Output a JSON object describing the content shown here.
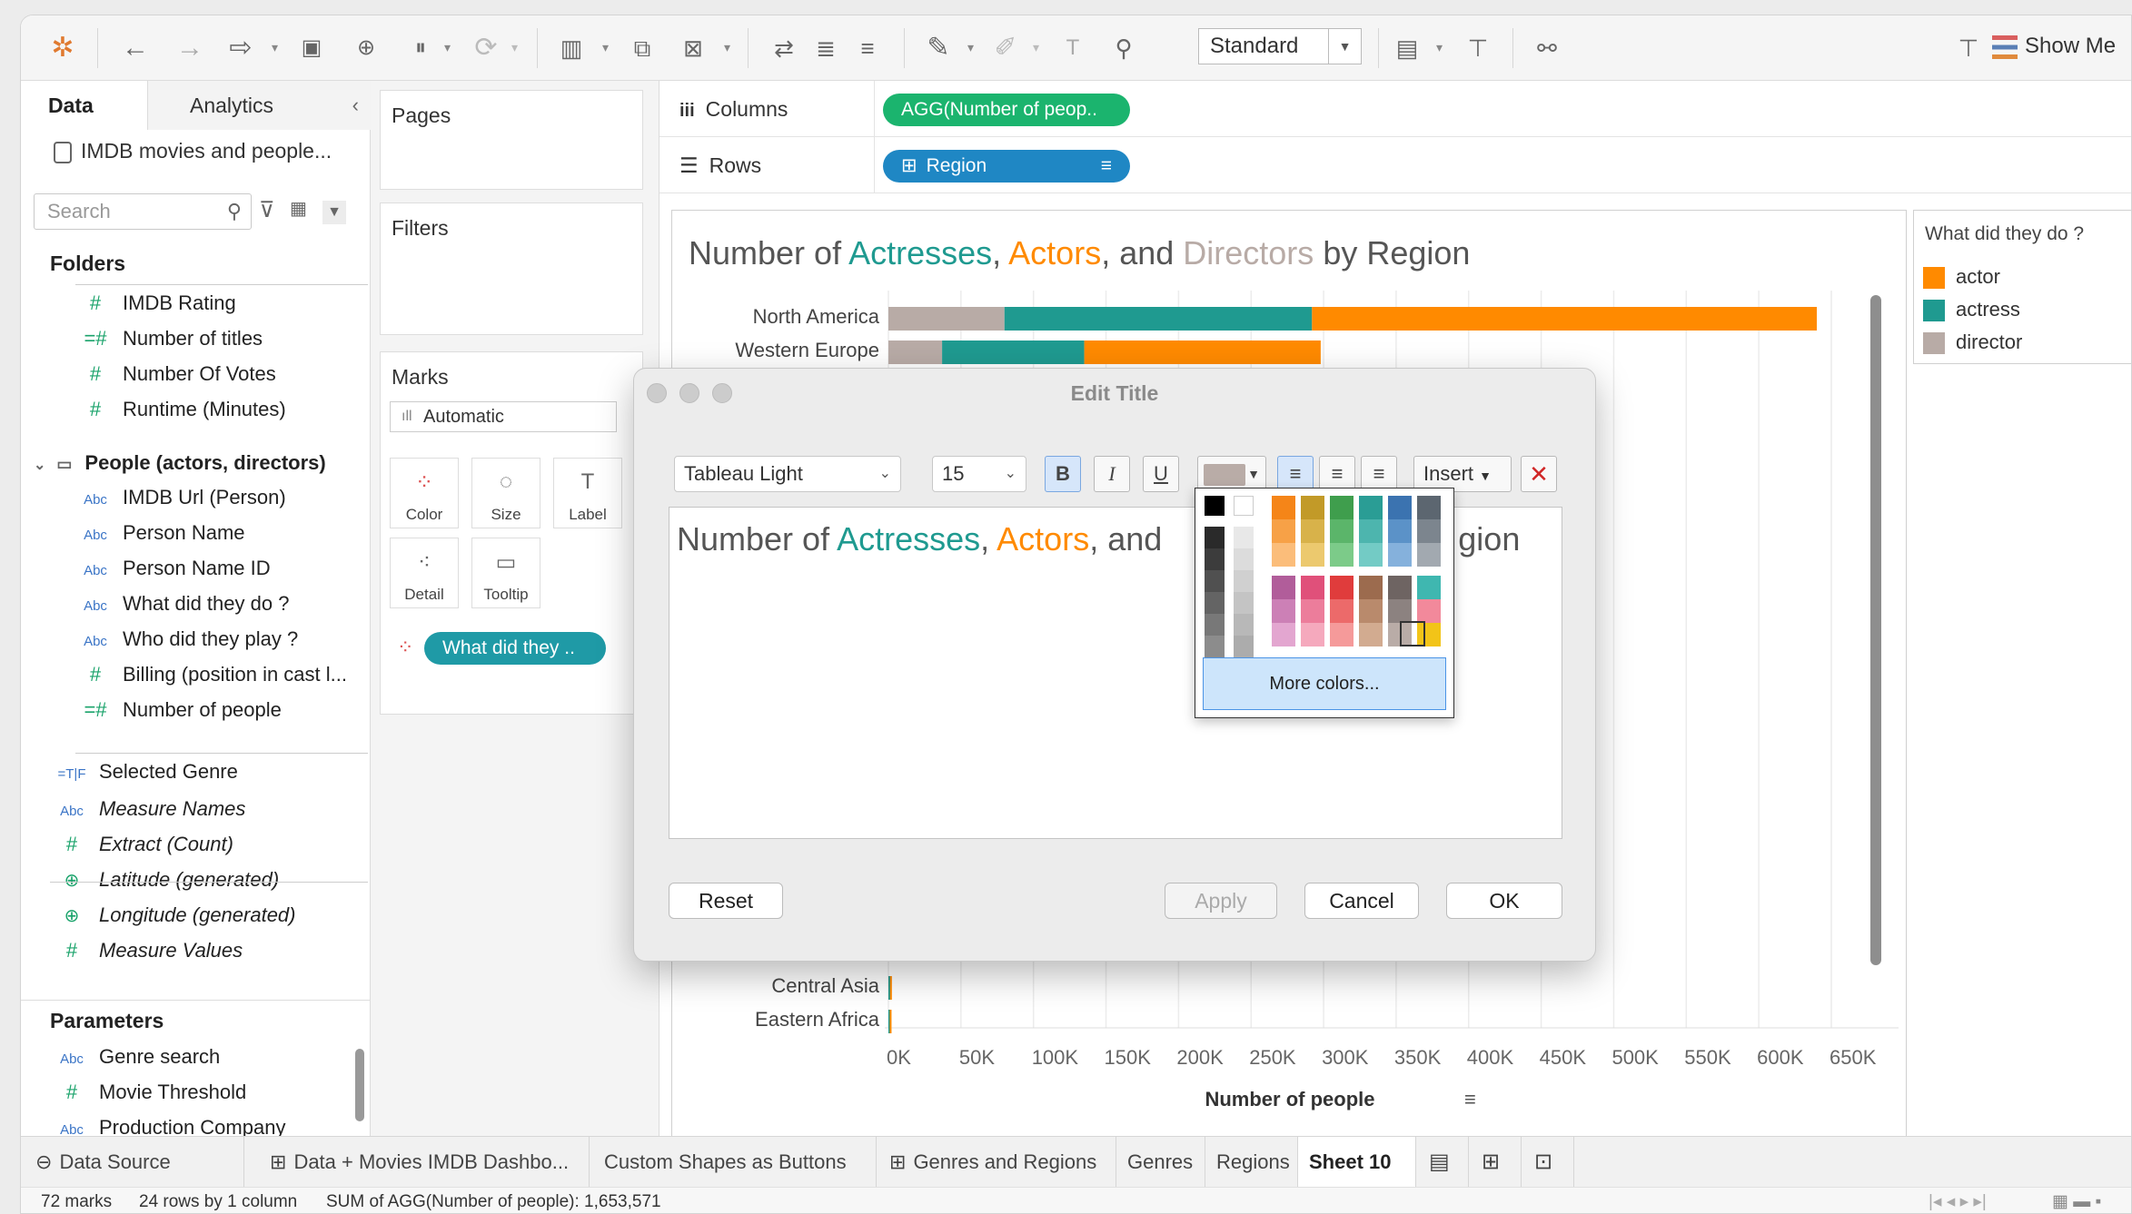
{
  "toolbar": {
    "view_size": "Standard",
    "show_me": "Show Me"
  },
  "sidebar": {
    "tab_data": "Data",
    "tab_analytics": "Analytics",
    "datasource": "IMDB movies and people...",
    "search_placeholder": "Search",
    "folders_label": "Folders",
    "fields_a": [
      {
        "icon": "#",
        "label": "IMDB Rating"
      },
      {
        "icon": "=#",
        "label": "Number of titles"
      },
      {
        "icon": "#",
        "label": "Number Of Votes"
      },
      {
        "icon": "#",
        "label": "Runtime (Minutes)"
      }
    ],
    "people_folder": "People (actors, directors)",
    "fields_b": [
      {
        "icon": "Abc",
        "label": "IMDB Url (Person)"
      },
      {
        "icon": "Abc",
        "label": "Person Name"
      },
      {
        "icon": "Abc",
        "label": "Person Name ID"
      },
      {
        "icon": "Abc",
        "label": "What did they do ?"
      },
      {
        "icon": "Abc",
        "label": "Who did they play ?"
      },
      {
        "icon": "#",
        "label": "Billing (position in cast l..."
      },
      {
        "icon": "=#",
        "label": "Number of people"
      }
    ],
    "fields_c": [
      {
        "icon": "=T|F",
        "label": "Selected Genre"
      },
      {
        "icon": "Abc",
        "label": "Measure Names"
      },
      {
        "icon": "#",
        "label": "Extract (Count)"
      },
      {
        "icon": "geo",
        "label": "Latitude (generated)"
      },
      {
        "icon": "geo",
        "label": "Longitude (generated)"
      },
      {
        "icon": "#",
        "label": "Measure Values"
      }
    ],
    "parameters_label": "Parameters",
    "parameters": [
      {
        "icon": "Abc",
        "label": "Genre search"
      },
      {
        "icon": "#",
        "label": "Movie Threshold"
      },
      {
        "icon": "Abc",
        "label": "Production Company"
      }
    ]
  },
  "pages_label": "Pages",
  "filters_label": "Filters",
  "marks": {
    "label": "Marks",
    "type": "Automatic",
    "buttons": [
      "Color",
      "Size",
      "Label",
      "Detail",
      "Tooltip"
    ],
    "pill": "What did they .."
  },
  "shelves": {
    "columns_label": "Columns",
    "columns_pill": "AGG(Number of peop..",
    "rows_label": "Rows",
    "rows_pill": "Region"
  },
  "chart_title": {
    "part1": "Number of ",
    "actresses": "Actresses",
    "comma": ", ",
    "actors": "Actors",
    "and": ", and ",
    "directors": "Directors",
    "tail": " by Region"
  },
  "chart_data": {
    "type": "bar",
    "orientation": "horizontal",
    "stacked": true,
    "categories": [
      "North America",
      "Western Europe",
      "Central Asia",
      "Eastern Africa"
    ],
    "series": [
      {
        "name": "director",
        "values": [
          80000,
          37000,
          0,
          0
        ]
      },
      {
        "name": "actress",
        "values": [
          212000,
          98000,
          1100,
          900
        ]
      },
      {
        "name": "actor",
        "values": [
          348000,
          163000,
          1300,
          1100
        ]
      }
    ],
    "xlabel": "Number of people",
    "xlim": [
      0,
      650000
    ],
    "xticks": [
      "0K",
      "50K",
      "100K",
      "150K",
      "200K",
      "250K",
      "300K",
      "350K",
      "400K",
      "450K",
      "500K",
      "550K",
      "600K",
      "650K"
    ],
    "legend_position": "right"
  },
  "colors": {
    "actor": "#ff8a00",
    "actress": "#1f9a90",
    "director": "#b8aba6"
  },
  "legend": {
    "title": "What did they do ?",
    "items": [
      "actor",
      "actress",
      "director"
    ]
  },
  "dialog": {
    "title": "Edit Title",
    "font": "Tableau Light",
    "size": "15",
    "bold": "B",
    "italic": "I",
    "underline": "U",
    "insert": "Insert",
    "text_part1": "Number of ",
    "text_actresses": "Actresses",
    "text_comma": ", ",
    "text_actors": "Actors",
    "text_and": ", and",
    "text_tail": "gion",
    "reset": "Reset",
    "apply": "Apply",
    "cancel": "Cancel",
    "ok": "OK",
    "more_colors": "More colors..."
  },
  "bottom_tabs": [
    {
      "label": "Data Source"
    },
    {
      "label": "Data + Movies IMDB Dashbo..."
    },
    {
      "label": "Custom Shapes as Buttons"
    },
    {
      "label": "Genres and Regions"
    },
    {
      "label": "Genres"
    },
    {
      "label": "Regions"
    },
    {
      "label": "Sheet 10"
    }
  ],
  "status": {
    "marks": "72 marks",
    "rows": "24 rows by 1 column",
    "sum": "SUM of AGG(Number of people): 1,653,571"
  }
}
